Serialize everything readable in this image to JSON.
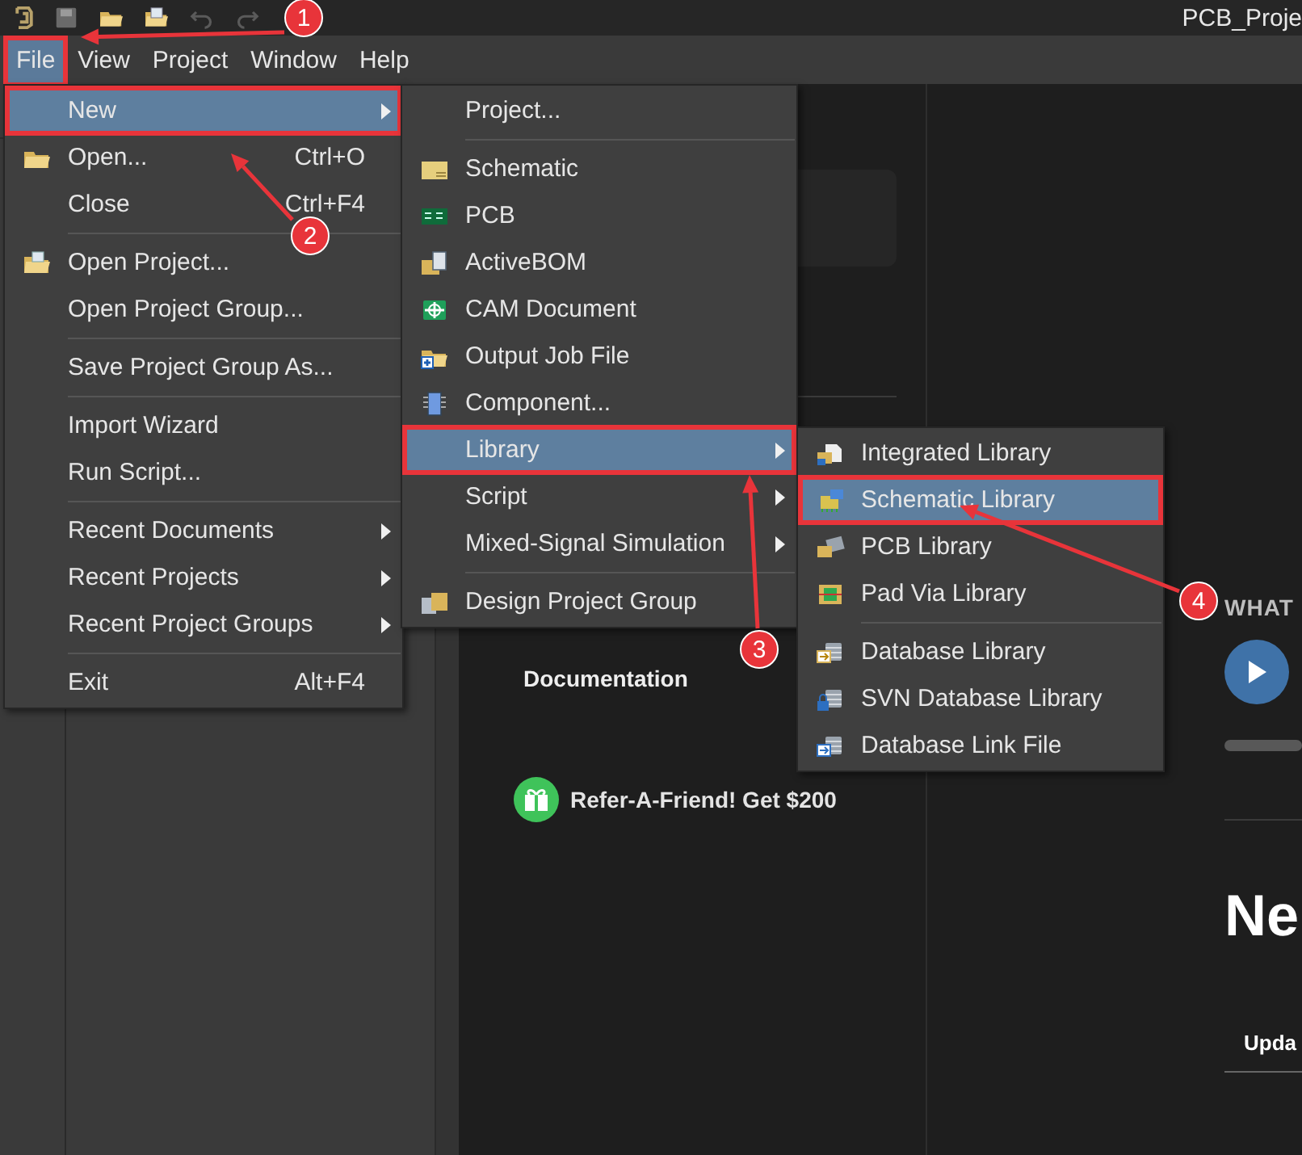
{
  "title_bar": {
    "title": "PCB_Proje"
  },
  "menu_bar": [
    {
      "label": "File",
      "selected": true,
      "highlighted": true
    },
    {
      "label": "View",
      "selected": false,
      "highlighted": false
    },
    {
      "label": "Project",
      "selected": false,
      "highlighted": false
    },
    {
      "label": "Window",
      "selected": false,
      "highlighted": false
    },
    {
      "label": "Help",
      "selected": false,
      "highlighted": false
    }
  ],
  "file_menu": [
    {
      "kind": "submenu",
      "label": "New",
      "selected": true,
      "highlighted": true
    },
    {
      "kind": "command",
      "label": "Open...",
      "shortcut": "Ctrl+O",
      "selected": false,
      "highlighted": false
    },
    {
      "kind": "command",
      "label": "Close",
      "shortcut": "Ctrl+F4",
      "selected": false,
      "highlighted": false
    },
    {
      "kind": "separator"
    },
    {
      "kind": "command",
      "label": "Open Project...",
      "selected": false,
      "highlighted": false
    },
    {
      "kind": "command",
      "label": "Open Project Group...",
      "selected": false,
      "highlighted": false
    },
    {
      "kind": "separator"
    },
    {
      "kind": "command",
      "label": "Save Project Group As...",
      "selected": false,
      "highlighted": false
    },
    {
      "kind": "separator"
    },
    {
      "kind": "command",
      "label": "Import Wizard",
      "selected": false,
      "highlighted": false
    },
    {
      "kind": "command",
      "label": "Run Script...",
      "selected": false,
      "highlighted": false
    },
    {
      "kind": "separator"
    },
    {
      "kind": "submenu",
      "label": "Recent Documents",
      "selected": false,
      "highlighted": false
    },
    {
      "kind": "submenu",
      "label": "Recent Projects",
      "selected": false,
      "highlighted": false
    },
    {
      "kind": "submenu",
      "label": "Recent Project Groups",
      "selected": false,
      "highlighted": false
    },
    {
      "kind": "separator"
    },
    {
      "kind": "command",
      "label": "Exit",
      "shortcut": "Alt+F4",
      "selected": false,
      "highlighted": false
    }
  ],
  "new_menu": [
    {
      "kind": "command",
      "label": "Project...",
      "selected": false,
      "highlighted": false
    },
    {
      "kind": "separator"
    },
    {
      "kind": "command",
      "label": "Schematic",
      "selected": false,
      "highlighted": false
    },
    {
      "kind": "command",
      "label": "PCB",
      "selected": false,
      "highlighted": false
    },
    {
      "kind": "command",
      "label": "ActiveBOM",
      "selected": false,
      "highlighted": false
    },
    {
      "kind": "command",
      "label": "CAM Document",
      "selected": false,
      "highlighted": false
    },
    {
      "kind": "command",
      "label": "Output Job File",
      "selected": false,
      "highlighted": false
    },
    {
      "kind": "command",
      "label": "Component...",
      "selected": false,
      "highlighted": false
    },
    {
      "kind": "submenu",
      "label": "Library",
      "selected": true,
      "highlighted": true
    },
    {
      "kind": "submenu",
      "label": "Script",
      "selected": false,
      "highlighted": false
    },
    {
      "kind": "submenu",
      "label": "Mixed-Signal Simulation",
      "selected": false,
      "highlighted": false
    },
    {
      "kind": "separator"
    },
    {
      "kind": "command",
      "label": "Design Project Group",
      "selected": false,
      "highlighted": false
    }
  ],
  "library_menu": [
    {
      "kind": "command",
      "label": "Integrated Library",
      "selected": false,
      "highlighted": false
    },
    {
      "kind": "command",
      "label": "Schematic Library",
      "selected": true,
      "highlighted": true
    },
    {
      "kind": "command",
      "label": "PCB Library",
      "selected": false,
      "highlighted": false
    },
    {
      "kind": "command",
      "label": "Pad Via Library",
      "selected": false,
      "highlighted": false
    },
    {
      "kind": "separator"
    },
    {
      "kind": "command",
      "label": "Database Library",
      "selected": false,
      "highlighted": false
    },
    {
      "kind": "command",
      "label": "SVN Database Library",
      "selected": false,
      "highlighted": false
    },
    {
      "kind": "command",
      "label": "Database Link File",
      "selected": false,
      "highlighted": false
    }
  ],
  "home": {
    "documentation_link": "Documentation",
    "refer_link": "Refer-A-Friend! Get $200",
    "whats_new_heading": "WHAT",
    "news_heading": "Ne",
    "updates_tab": "Upda"
  },
  "annotations": [
    {
      "label": "1"
    },
    {
      "label": "2"
    },
    {
      "label": "3"
    },
    {
      "label": "4"
    }
  ]
}
